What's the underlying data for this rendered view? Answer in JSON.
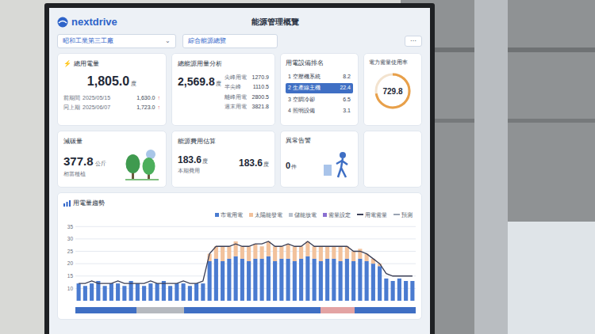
{
  "logo": {
    "text": "nextdrive"
  },
  "header": {
    "site": "昭和工業第三工廠",
    "site_arrow": "⌄",
    "view": "綜合能源總覽",
    "title": "能源管理概覽",
    "menu": "⋯"
  },
  "usage_card": {
    "icon": "⚡",
    "title": "總用電量",
    "value": "1,805.0",
    "unit": "度",
    "rows": [
      {
        "label": "前期間",
        "date": "2025/05/15",
        "value": "1,630.0",
        "arrow": "↑"
      },
      {
        "label": "同上期",
        "date": "2025/06/07",
        "value": "1,723.0",
        "arrow": "↑"
      }
    ]
  },
  "analysis_card": {
    "title": "總能源用量分析",
    "value": "2,569.8",
    "unit": "度",
    "rows": [
      {
        "label": "尖峰用電",
        "value": "1270.9"
      },
      {
        "label": "半尖峰",
        "value": "1110.5"
      },
      {
        "label": "離峰用電",
        "value": "2800.5"
      },
      {
        "label": "週末用電",
        "value": "3821.8"
      }
    ]
  },
  "ranking_card": {
    "title": "用電設備排名",
    "rows": [
      {
        "label": "1 空壓機系統",
        "value": "8.2",
        "selected": false
      },
      {
        "label": "2 生產線主機",
        "value": "22.4",
        "selected": true
      },
      {
        "label": "3 空調冷卻",
        "value": "6.5",
        "selected": false
      },
      {
        "label": "4 照明設備",
        "value": "3.1",
        "selected": false
      }
    ]
  },
  "demand_card": {
    "title": "電力需量使用率",
    "value": "729.8",
    "level": 0.72
  },
  "carbon_card": {
    "title": "減碳量",
    "value": "377.8",
    "unit": "公斤",
    "sub": "相當種植"
  },
  "cost_card": {
    "title": "能源費用估算",
    "value1": "183.6",
    "unit1": "度",
    "sub1": "本期費用",
    "value2": "183.6",
    "unit2": "度"
  },
  "alarm_card": {
    "title": "異常告警",
    "value": "0",
    "unit": "件"
  },
  "chart": {
    "title": "用電量趨勢",
    "legend": [
      {
        "label": "市電用電",
        "color": "#4a7bd0",
        "kind": "bar"
      },
      {
        "label": "太陽能發電",
        "color": "#f2c29c",
        "kind": "bar"
      },
      {
        "label": "儲能放電",
        "color": "#b9c2cf",
        "kind": "bar"
      },
      {
        "label": "需量設定",
        "color": "#8a6fd1",
        "kind": "bar"
      },
      {
        "label": "用電需量",
        "color": "#3b3f56",
        "kind": "line"
      },
      {
        "label": "預測",
        "color": "#9aa3b2",
        "kind": "line"
      }
    ],
    "y_ticks": [
      "35",
      "30",
      "25",
      "20",
      "15",
      "10"
    ],
    "axis_min": 5,
    "axis_max": 37,
    "grid": [
      12,
      11,
      12,
      13,
      11,
      12,
      12,
      11,
      13,
      12,
      11,
      12,
      12,
      13,
      11,
      12,
      12,
      11,
      12,
      12,
      21,
      22,
      21,
      22,
      23,
      22,
      21,
      22,
      22,
      23,
      21,
      22,
      22,
      21,
      22,
      23,
      22,
      21,
      22,
      22,
      21,
      22,
      21,
      22,
      21,
      20,
      19,
      14,
      13,
      14,
      13,
      13
    ],
    "solar": [
      0,
      0,
      0,
      0,
      0,
      0,
      0,
      0,
      0,
      0,
      0,
      0,
      0,
      0,
      0,
      0,
      0,
      0,
      0,
      0,
      3,
      5,
      6,
      5,
      6,
      5,
      6,
      6,
      5,
      6,
      6,
      5,
      6,
      6,
      5,
      6,
      5,
      6,
      5,
      5,
      6,
      5,
      4,
      4,
      3,
      2,
      1,
      0,
      0,
      0,
      0,
      0
    ],
    "demand": [
      12,
      12,
      13,
      12,
      12,
      12,
      13,
      12,
      12,
      12,
      12,
      13,
      12,
      12,
      12,
      12,
      13,
      12,
      12,
      13,
      24,
      27,
      27,
      27,
      28,
      27,
      27,
      28,
      28,
      29,
      27,
      27,
      28,
      27,
      27,
      29,
      27,
      27,
      27,
      27,
      27,
      27,
      25,
      25,
      24,
      22,
      20,
      16,
      15,
      15,
      15,
      15
    ]
  },
  "timeline": [
    {
      "level": 0.18,
      "color": "#3f6fc4"
    },
    {
      "level": 0.14,
      "color": "#b5b9bf"
    },
    {
      "level": 0.4,
      "color": "#3f6fc4"
    },
    {
      "level": 0.1,
      "color": "#e3a3a3"
    },
    {
      "level": 0.18,
      "color": "#3f6fc4"
    }
  ]
}
